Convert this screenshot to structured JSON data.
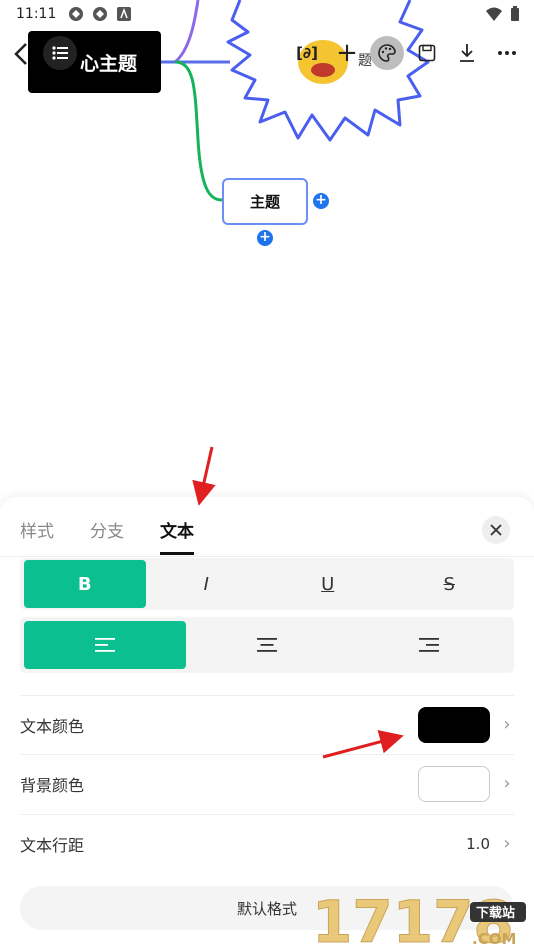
{
  "status_bar": {
    "time": "11:11"
  },
  "canvas": {
    "central_topic_label": "心主题",
    "topic_label": "主题",
    "floating_label": "题",
    "add_symbol": "+"
  },
  "toolbar": {
    "formula_label": "[∂]",
    "add_label": "+"
  },
  "sheet": {
    "tabs": [
      {
        "label": "样式"
      },
      {
        "label": "分支"
      },
      {
        "label": "文本"
      }
    ],
    "close_symbol": "×",
    "style_buttons": {
      "bold": "B",
      "italic": "I",
      "underline": "U",
      "strike": "S"
    },
    "rows": {
      "text_color_label": "文本颜色",
      "background_color_label": "背景颜色",
      "line_spacing_label": "文本行距",
      "line_spacing_value": "1.0"
    },
    "default_button": "默认格式"
  },
  "colors": {
    "accent": "#0bbf8f",
    "text_color_swatch": "#000000",
    "background_color_swatch": "#ffffff",
    "annotation_arrow": "#e02020",
    "branch_purple": "#8a6ae8",
    "branch_blue": "#5a6ee8",
    "branch_green": "#15b35a"
  },
  "watermark": {
    "number": "17178",
    "suffix": ".COM",
    "badge": "下载站"
  }
}
